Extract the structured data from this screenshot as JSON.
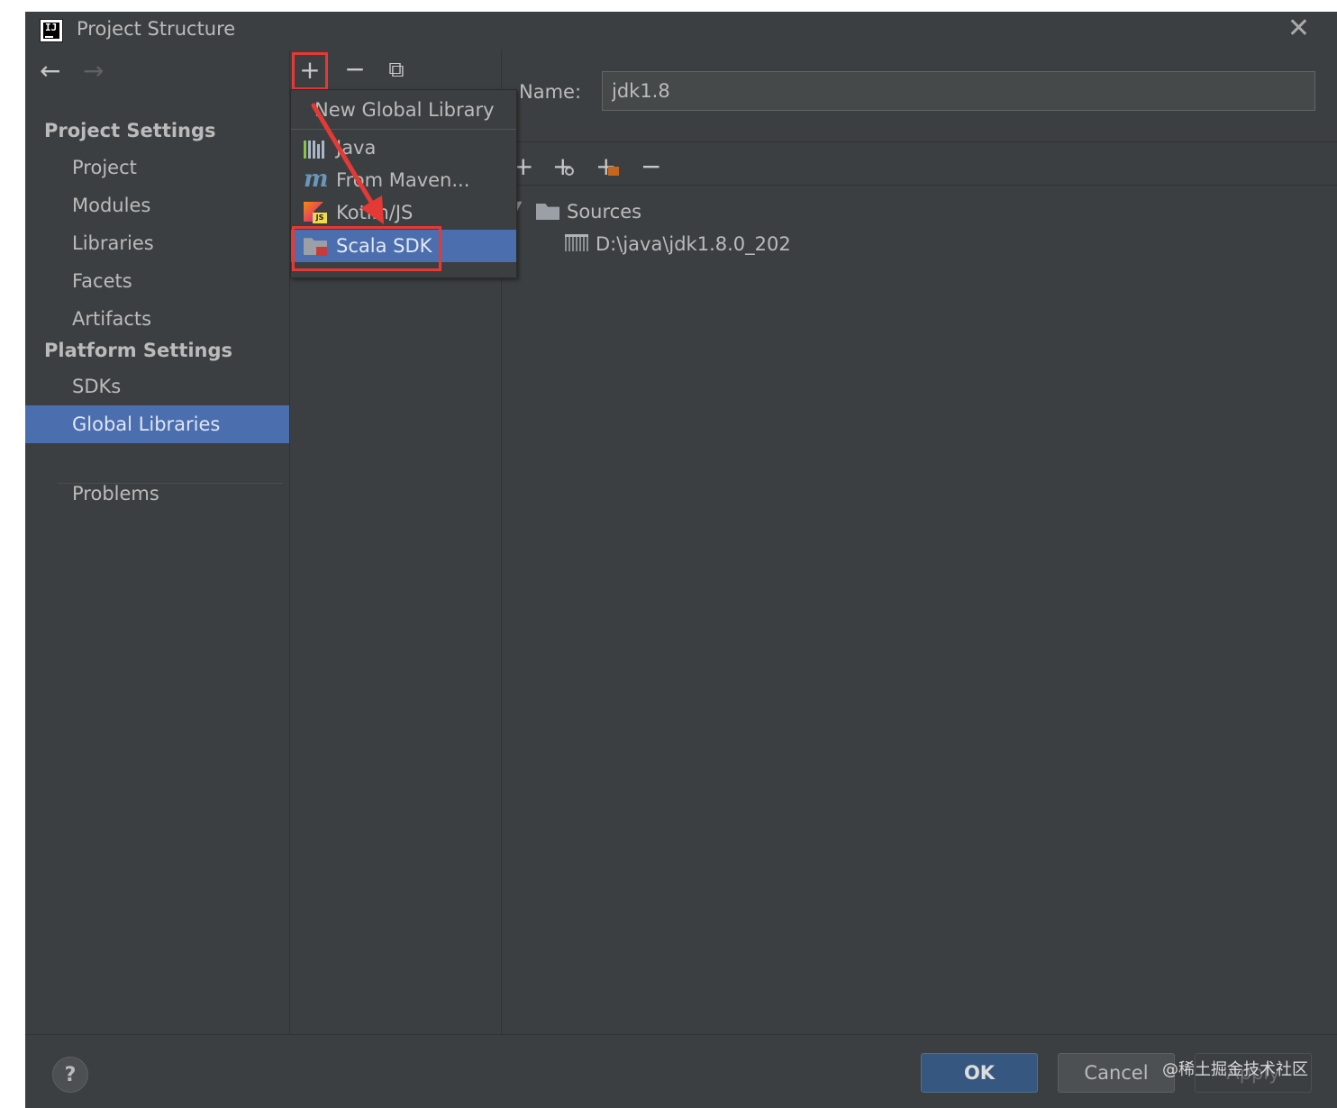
{
  "window": {
    "title": "Project Structure",
    "app_icon_text": "IJ"
  },
  "sidebar": {
    "project_settings_title": "Project Settings",
    "project_items": [
      "Project",
      "Modules",
      "Libraries",
      "Facets",
      "Artifacts"
    ],
    "platform_settings_title": "Platform Settings",
    "platform_items": [
      "SDKs",
      "Global Libraries"
    ],
    "selected_item": "Global Libraries",
    "problems_label": "Problems"
  },
  "middle": {
    "add_icon": "plus-icon",
    "remove_icon": "minus-icon",
    "copy_icon": "copy-icon"
  },
  "popup": {
    "header": "New Global Library",
    "items": [
      {
        "label": "Java",
        "icon": "java-library-icon"
      },
      {
        "label": "From Maven...",
        "icon": "maven-icon"
      },
      {
        "label": "Kotlin/JS",
        "icon": "kotlin-js-icon"
      },
      {
        "label": "Scala SDK",
        "icon": "scala-sdk-icon"
      }
    ],
    "selected": "Scala SDK",
    "highlight_color": "#e53935"
  },
  "detail": {
    "name_label": "Name:",
    "name_value": "jdk1.8",
    "tree": {
      "folder_label": "Sources",
      "entry_label": "D:\\java\\jdk1.8.0_202"
    }
  },
  "footer": {
    "help_label": "?",
    "ok_label": "OK",
    "cancel_label": "Cancel",
    "apply_label": "Apply",
    "watermark": "@稀土掘金技术社区"
  },
  "colors": {
    "background": "#3c3f41",
    "selection": "#4b6eaf",
    "ok_button": "#365880",
    "annotation_red": "#e53935"
  }
}
